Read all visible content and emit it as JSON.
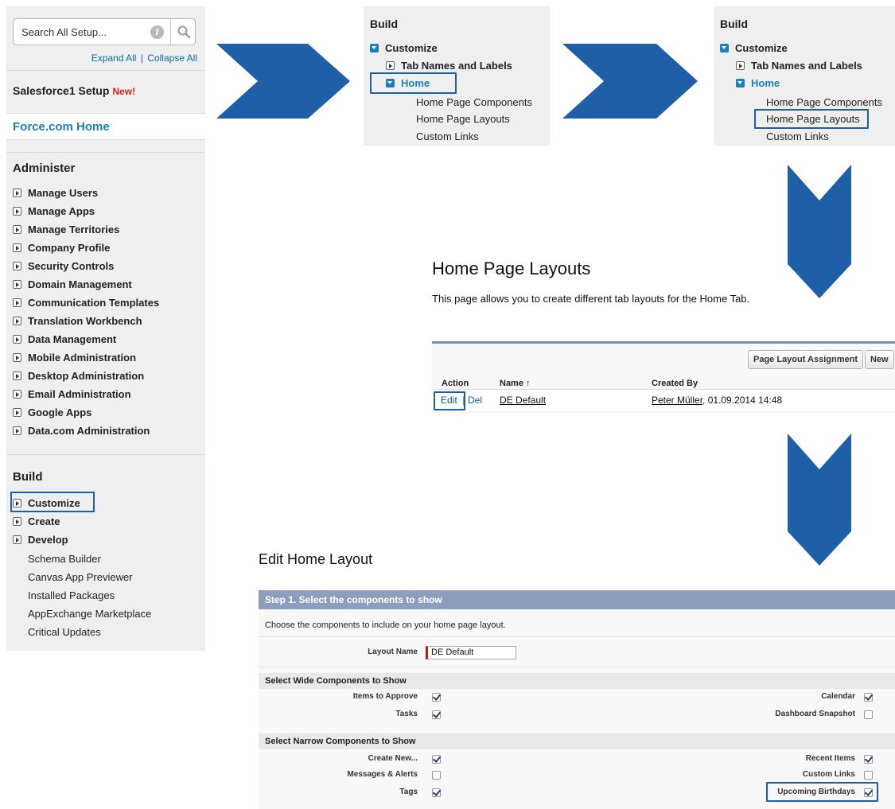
{
  "sidebar": {
    "search_placeholder": "Search All Setup...",
    "info_icon_text": "i",
    "expand_all": "Expand All",
    "collapse_all": "Collapse All",
    "separator": "|",
    "sf1_title": "Salesforce1 Setup",
    "sf1_new": "New!",
    "force_home": "Force.com Home",
    "administer_title": "Administer",
    "administer_items": [
      "Manage Users",
      "Manage Apps",
      "Manage Territories",
      "Company Profile",
      "Security Controls",
      "Domain Management",
      "Communication Templates",
      "Translation Workbench",
      "Data Management",
      "Mobile Administration",
      "Desktop Administration",
      "Email Administration",
      "Google Apps",
      "Data.com Administration"
    ],
    "build_title": "Build",
    "build_items": [
      "Customize",
      "Create",
      "Develop"
    ],
    "build_plain_items": [
      "Schema Builder",
      "Canvas App Previewer",
      "Installed Packages",
      "AppExchange Marketplace",
      "Critical Updates"
    ]
  },
  "panel1": {
    "title": "Build",
    "customize": "Customize",
    "tab_names": "Tab Names and Labels",
    "home": "Home",
    "items": [
      "Home Page Components",
      "Home Page Layouts",
      "Custom Links"
    ]
  },
  "panel2": {
    "title": "Build",
    "customize": "Customize",
    "tab_names": "Tab Names and Labels",
    "home": "Home",
    "items": [
      "Home Page Components",
      "Home Page Layouts",
      "Custom Links"
    ]
  },
  "hpl": {
    "title": "Home Page Layouts",
    "description": "This page allows you to create different tab layouts for the Home Tab.",
    "btn_assignment": "Page Layout Assignment",
    "btn_new": "New",
    "col_action": "Action",
    "col_name": "Name",
    "sort_arrow": "↑",
    "col_created": "Created By",
    "edit": "Edit",
    "sep": "|",
    "del": "Del",
    "name_value": "DE Default",
    "created_user": "Peter Müller",
    "created_date": ", 01.09.2014 14:48"
  },
  "ehl": {
    "title": "Edit Home Layout",
    "step": "Step 1. Select the components to show",
    "choose": "Choose the components to include on your home page layout.",
    "layout_name_label": "Layout Name",
    "layout_name_value": "DE Default",
    "wide_title": "Select Wide Components to Show",
    "wide_left": [
      {
        "label": "Items to Approve",
        "checked": true
      },
      {
        "label": "Tasks",
        "checked": true
      }
    ],
    "wide_right": [
      {
        "label": "Calendar",
        "checked": true
      },
      {
        "label": "Dashboard Snapshot",
        "checked": false
      }
    ],
    "narrow_title": "Select Narrow Components to Show",
    "narrow_left": [
      {
        "label": "Create New...",
        "checked": true
      },
      {
        "label": "Messages & Alerts",
        "checked": false
      },
      {
        "label": "Tags",
        "checked": true
      }
    ],
    "narrow_right": [
      {
        "label": "Recent Items",
        "checked": true
      },
      {
        "label": "Custom Links",
        "checked": false
      },
      {
        "label": "Upcoming Birthdays",
        "checked": true
      }
    ]
  },
  "colors": {
    "link_blue": "#1a7fc1",
    "highlight_blue": "#1e5fa8",
    "arrow_blue": "#1e5fa8",
    "new_red": "#e0201a",
    "step_bar": "#8d9dbe"
  }
}
